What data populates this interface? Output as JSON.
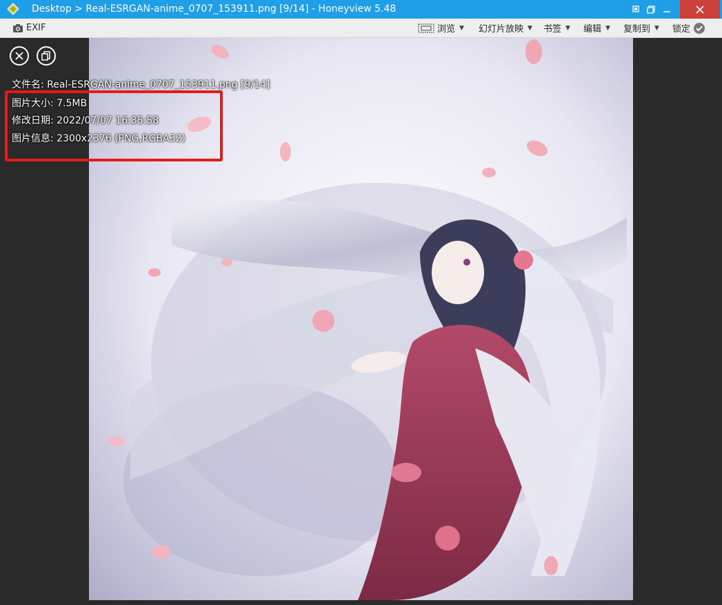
{
  "titlebar": {
    "title": "Desktop > Real-ESRGAN-anime_0707_153911.png [9/14] - Honeyview 5.48",
    "icons": [
      "honeyview-logo-icon",
      "pin-icon",
      "restore-icon",
      "minimize-icon",
      "close-icon"
    ],
    "accent": "#1e9fe7",
    "close_color": "#c9413a"
  },
  "toolbar": {
    "exif_label": "EXIF",
    "browse_label": "浏览",
    "slideshow_label": "幻灯片放映",
    "bookmark_label": "书签",
    "edit_label": "编辑",
    "copy_to_label": "复制到",
    "lock_label": "锁定"
  },
  "overlay": {
    "close_icon": "close-circle-icon",
    "copy_icon": "copy-info-icon",
    "lines": [
      "文件名: Real-ESRGAN-anime_0707_153911.png [9/14]",
      "图片大小: 7.5MB",
      "修改日期: 2022/07/07 16:35:58",
      "图片信息: 2300x2376 (PNG,RGBA32)"
    ],
    "highlight_color": "#e21b1b"
  }
}
